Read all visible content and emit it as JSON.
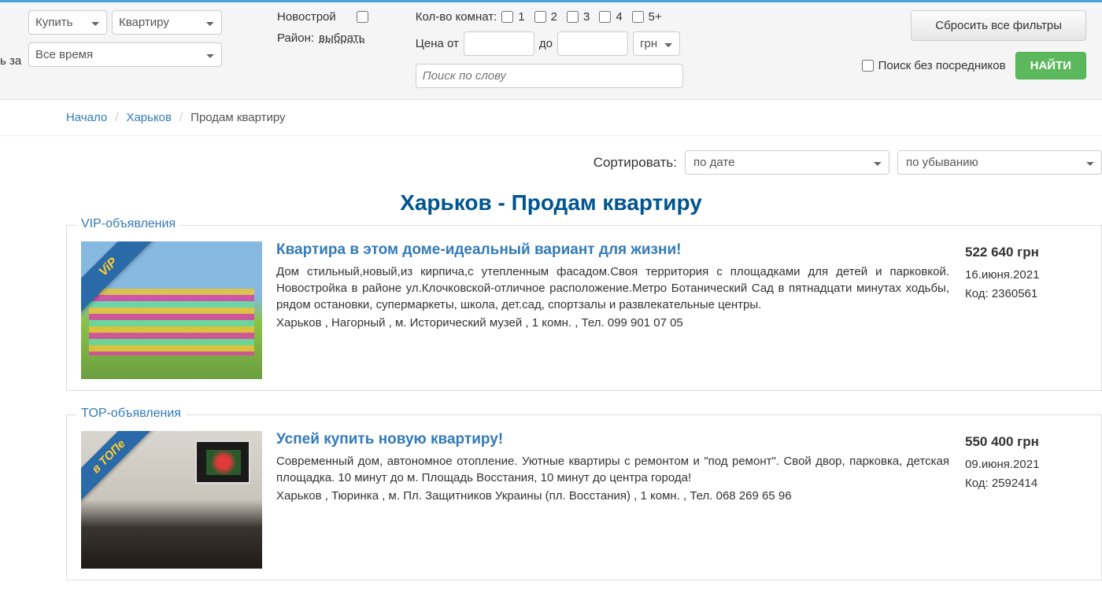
{
  "filters": {
    "action_select": "Купить",
    "type_select": "Квартиру",
    "time_label_partial": "ь за",
    "time_select": "Все время",
    "newbuild_label": "Новострой",
    "district_label": "Район:",
    "district_link": "выбрать",
    "rooms_label": "Кол-во комнат:",
    "rooms": [
      "1",
      "2",
      "3",
      "4",
      "5+"
    ],
    "price_from_label": "Цена от",
    "price_to_label": "до",
    "currency": "грн",
    "search_placeholder": "Поиск по слову",
    "reset_button": "Сбросить все фильтры",
    "no_agents_label": "Поиск без посредников",
    "find_button": "НАЙТИ"
  },
  "breadcrumb": {
    "home": "Начало",
    "city": "Харьков",
    "current": "Продам квартиру"
  },
  "sort": {
    "label": "Сортировать:",
    "by": "по дате",
    "direction": "по убыванию"
  },
  "page_title": "Харьков - Продам квартиру",
  "sections": {
    "vip_legend": "VIP-объявления",
    "top_legend": "TOP-объявления"
  },
  "ribbons": {
    "vip": "ViP",
    "top": "в ТОПе"
  },
  "listings": [
    {
      "title": "Квартира в этом доме-идеальный вариант для жизни!",
      "desc": "Дом стильный,новый,из кирпича,с утепленным фасадом.Своя территория с площадками для детей и парковкой. Новостройка в районе ул.Клочковской-отличное расположение.Метро Ботанический Сад в пятнадцати минутах ходьбы, рядом остановки, супермаркеты, школа, дет.сад, спортзалы и развлекательные центры.",
      "meta": "Харьков ,  Нагорный ,  м. Исторический музей ,   1 комн. ,   Тел. 099 901 07 05",
      "price": "522 640 грн",
      "date": "16.июня.2021",
      "code": "Код: 2360561"
    },
    {
      "title": "Успей купить новую квартиру!",
      "desc": "Современный дом, автономное отопление. Уютные квартиры с ремонтом и \"под ремонт\". Свой двор, парковка, детская площадка. 10 минут до м. Площадь Восстания, 10 минут до центра города!",
      "meta": "Харьков ,  Тюринка ,  м. Пл. Защитников Украины (пл. Восстания) ,   1 комн. ,   Тел. 068 269 65 96",
      "price": "550 400 грн",
      "date": "09.июня.2021",
      "code": "Код: 2592414"
    }
  ]
}
